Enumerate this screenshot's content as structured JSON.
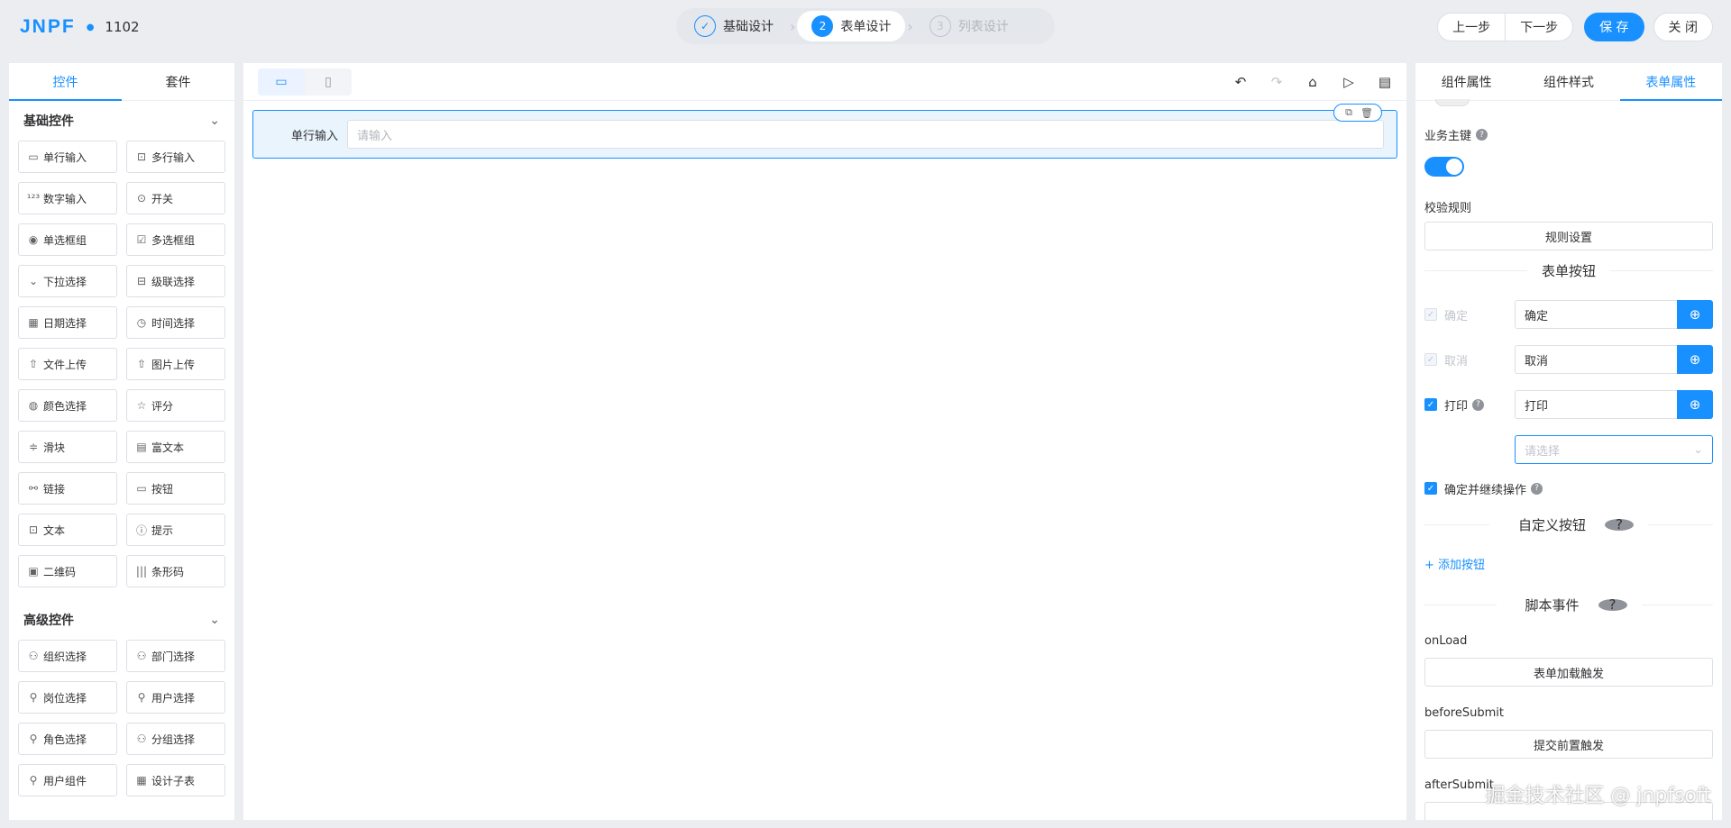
{
  "header": {
    "logo": "JNPF",
    "doc_name": "1102",
    "steps": [
      {
        "num": "✓",
        "label": "基础设计"
      },
      {
        "num": "2",
        "label": "表单设计"
      },
      {
        "num": "3",
        "label": "列表设计"
      }
    ],
    "prev_label": "上一步",
    "next_label": "下一步",
    "save_label": "保 存",
    "close_label": "关 闭"
  },
  "left": {
    "tabs": [
      "控件",
      "套件"
    ],
    "basic_title": "基础控件",
    "basic_items": [
      {
        "icon": "▭",
        "label": "单行输入"
      },
      {
        "icon": "⊡",
        "label": "多行输入"
      },
      {
        "icon": "¹²³",
        "label": "数字输入"
      },
      {
        "icon": "⊙",
        "label": "开关"
      },
      {
        "icon": "◉",
        "label": "单选框组"
      },
      {
        "icon": "☑",
        "label": "多选框组"
      },
      {
        "icon": "⌄",
        "label": "下拉选择"
      },
      {
        "icon": "⊟",
        "label": "级联选择"
      },
      {
        "icon": "▦",
        "label": "日期选择"
      },
      {
        "icon": "◷",
        "label": "时间选择"
      },
      {
        "icon": "⇧",
        "label": "文件上传"
      },
      {
        "icon": "⇧",
        "label": "图片上传"
      },
      {
        "icon": "◍",
        "label": "颜色选择"
      },
      {
        "icon": "☆",
        "label": "评分"
      },
      {
        "icon": "≑",
        "label": "滑块"
      },
      {
        "icon": "▤",
        "label": "富文本"
      },
      {
        "icon": "⚯",
        "label": "链接"
      },
      {
        "icon": "▭",
        "label": "按钮"
      },
      {
        "icon": "⊡",
        "label": "文本"
      },
      {
        "icon": "ⓘ",
        "label": "提示"
      },
      {
        "icon": "▣",
        "label": "二维码"
      },
      {
        "icon": "|||",
        "label": "条形码"
      }
    ],
    "adv_title": "高级控件",
    "adv_items": [
      {
        "icon": "⚇",
        "label": "组织选择"
      },
      {
        "icon": "⚇",
        "label": "部门选择"
      },
      {
        "icon": "⚲",
        "label": "岗位选择"
      },
      {
        "icon": "⚲",
        "label": "用户选择"
      },
      {
        "icon": "⚲",
        "label": "角色选择"
      },
      {
        "icon": "⚇",
        "label": "分组选择"
      },
      {
        "icon": "⚲",
        "label": "用户组件"
      },
      {
        "icon": "▦",
        "label": "设计子表"
      }
    ]
  },
  "canvas": {
    "field_label": "单行输入",
    "field_placeholder": "请输入"
  },
  "right": {
    "tabs": [
      "组件属性",
      "组件样式",
      "表单属性"
    ],
    "biz_key_label": "业务主键",
    "validate_label": "校验规则",
    "rule_btn": "规则设置",
    "form_buttons_title": "表单按钮",
    "confirm_label": "确定",
    "confirm_value": "确定",
    "cancel_label": "取消",
    "cancel_value": "取消",
    "print_label": "打印",
    "print_value": "打印",
    "print_select_placeholder": "请选择",
    "continue_label": "确定并继续操作",
    "custom_title": "自定义按钮",
    "add_btn": "+ 添加按钮",
    "script_title": "脚本事件",
    "onload_label": "onLoad",
    "onload_btn": "表单加载触发",
    "before_label": "beforeSubmit",
    "before_btn": "提交前置触发",
    "after_label": "afterSubmit"
  },
  "watermark": "掘金技术社区 @ jnpfsoft"
}
